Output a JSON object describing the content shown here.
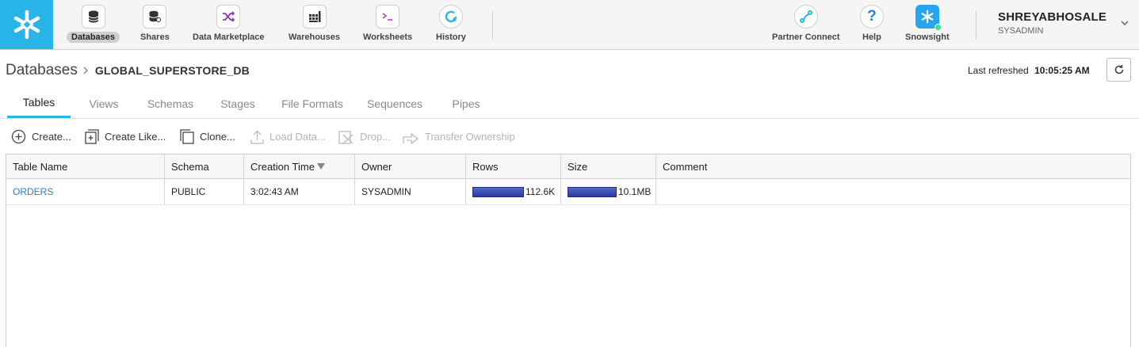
{
  "nav": {
    "items": [
      {
        "label": "Databases",
        "icon": "database-icon"
      },
      {
        "label": "Shares",
        "icon": "share-database-icon"
      },
      {
        "label": "Data Marketplace",
        "icon": "shuffle-icon"
      },
      {
        "label": "Warehouses",
        "icon": "grid-icon"
      },
      {
        "label": "Worksheets",
        "icon": "terminal-icon"
      },
      {
        "label": "History",
        "icon": "history-icon"
      }
    ],
    "right_items": [
      {
        "label": "Partner Connect",
        "icon": "link-icon"
      },
      {
        "label": "Help",
        "icon": "help-icon"
      },
      {
        "label": "Snowsight",
        "icon": "snowsight-icon"
      }
    ],
    "active": "Databases"
  },
  "user": {
    "name": "SHREYABHOSALE",
    "role": "SYSADMIN"
  },
  "header": {
    "root": "Databases",
    "database": "GLOBAL_SUPERSTORE_DB",
    "refreshed_label": "Last refreshed",
    "refreshed_time": "10:05:25 AM"
  },
  "tabs": [
    "Tables",
    "Views",
    "Schemas",
    "Stages",
    "File Formats",
    "Sequences",
    "Pipes"
  ],
  "toolbar": {
    "create": "Create...",
    "create_like": "Create Like...",
    "clone": "Clone...",
    "load": "Load Data...",
    "drop": "Drop...",
    "transfer": "Transfer Ownership"
  },
  "table": {
    "columns": [
      "Table Name",
      "Schema",
      "Creation Time",
      "Owner",
      "Rows",
      "Size",
      "Comment"
    ],
    "rows": [
      {
        "name": "ORDERS",
        "schema": "PUBLIC",
        "created": "3:02:43 AM",
        "owner": "SYSADMIN",
        "rows": "112.6K",
        "rows_fraction": 1.0,
        "size": "10.1MB",
        "size_fraction": 1.0,
        "comment": ""
      }
    ]
  },
  "colors": {
    "accent": "#29b5e8",
    "link": "#2a7fd0",
    "bar": "#2a3b9e"
  }
}
